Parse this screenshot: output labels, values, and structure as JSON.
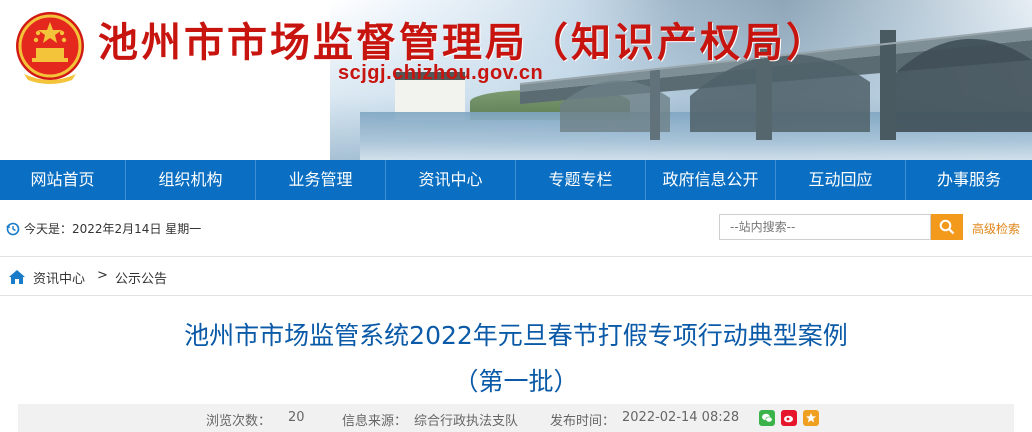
{
  "header": {
    "site_title": "池州市市场监督管理局（知识产权局）",
    "domain": "scjgj.chizhou.gov.cn"
  },
  "nav": {
    "items": [
      "网站首页",
      "组织机构",
      "业务管理",
      "资讯中心",
      "专题专栏",
      "政府信息公开",
      "互动回应",
      "办事服务"
    ]
  },
  "infobar": {
    "date_text": "今天是：2022年2月14日 星期一",
    "search_placeholder": "--站内搜索--",
    "advanced_search": "高级检索"
  },
  "breadcrumb": {
    "items": [
      "资讯中心",
      "公示公告"
    ],
    "separator": ">"
  },
  "article": {
    "title_line1": "池州市市场监管系统2022年元旦春节打假专项行动典型案例",
    "title_line2": "（第一批）",
    "views_label": "浏览次数：",
    "views": "20",
    "source_label": "信息来源：",
    "source": "综合行政执法支队",
    "published_label": "发布时间：",
    "published": "2022-02-14 08:28"
  },
  "colors": {
    "brand_red": "#c8140f",
    "nav_blue": "#0a6fc2",
    "title_blue": "#0a5aa8",
    "search_orange": "#f39a1c"
  },
  "icons": {
    "share": [
      "wechat-icon",
      "weibo-icon",
      "favorite-icon"
    ]
  }
}
